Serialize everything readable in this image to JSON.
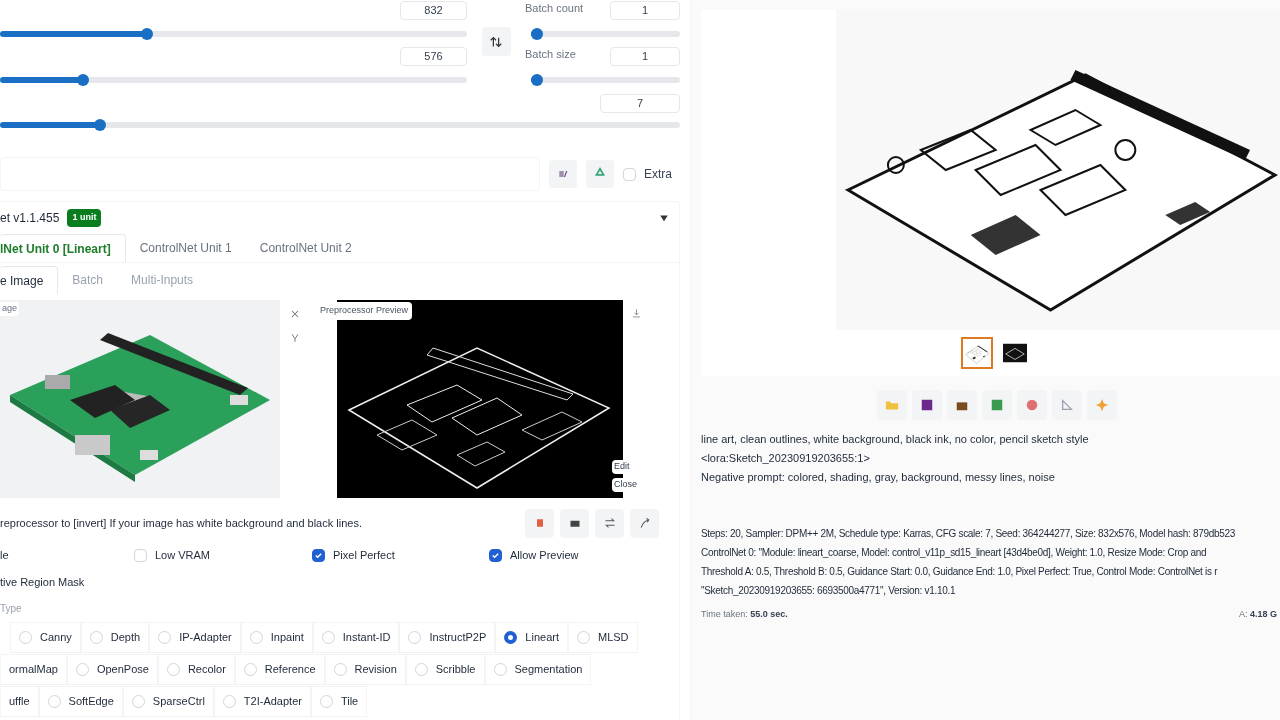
{
  "size_sliders": [
    {
      "value": "832",
      "level": 0.31
    },
    {
      "value": "576",
      "level": 0.17
    }
  ],
  "swap_button": {
    "kind": "swap"
  },
  "batch": [
    {
      "label": "Batch count",
      "value": "1",
      "level": 0
    },
    {
      "label": "Batch size",
      "value": "1",
      "level": 0
    }
  ],
  "cfg_slider": {
    "value": "7",
    "level": 0.14
  },
  "extra": {
    "label": "Extra",
    "checked": false
  },
  "controlnet": {
    "title": "et v1.1.455",
    "badge": "1 unit",
    "expanded": true,
    "unit_tabs": [
      {
        "label": "lNet Unit 0 [Lineart]",
        "selected": true
      },
      {
        "label": "ControlNet Unit 1",
        "selected": false
      },
      {
        "label": "ControlNet Unit 2",
        "selected": false
      }
    ],
    "input_tabs": [
      {
        "label": "e Image",
        "selected": true
      },
      {
        "label": "Batch",
        "selected": false
      },
      {
        "label": "Multi-Inputs",
        "selected": false
      }
    ],
    "image_label": "age",
    "preview_label": "Preprocessor Preview",
    "edit": "Edit",
    "close": "Close",
    "hint": "reprocessor to [invert] If your image has white background and black lines.",
    "options": [
      {
        "label": "le"
      },
      {
        "label": "Low VRAM",
        "checked": false
      },
      {
        "label": "Pixel Perfect",
        "checked": true
      },
      {
        "label": "Allow Preview",
        "checked": true
      }
    ],
    "mask_label": "tive Region Mask",
    "type_label": "Type",
    "control_types": [
      [
        {
          "label": "Canny",
          "selected": false
        },
        {
          "label": "Depth",
          "selected": false
        },
        {
          "label": "IP-Adapter",
          "selected": false
        },
        {
          "label": "Inpaint",
          "selected": false
        },
        {
          "label": "Instant-ID",
          "selected": false
        },
        {
          "label": "InstructP2P",
          "selected": false
        },
        {
          "label": "Lineart",
          "selected": true
        },
        {
          "label": "MLSD",
          "selected": false
        }
      ],
      [
        {
          "label": "ormalMap"
        },
        {
          "label": "OpenPose",
          "selected": false
        },
        {
          "label": "Recolor",
          "selected": false
        },
        {
          "label": "Reference",
          "selected": false
        },
        {
          "label": "Revision",
          "selected": false
        },
        {
          "label": "Scribble",
          "selected": false
        },
        {
          "label": "Segmentation",
          "selected": false
        }
      ],
      [
        {
          "label": "uffle"
        },
        {
          "label": "SoftEdge",
          "selected": false
        },
        {
          "label": "SparseCtrl",
          "selected": false
        },
        {
          "label": "T2I-Adapter",
          "selected": false
        },
        {
          "label": "Tile",
          "selected": false
        }
      ]
    ]
  },
  "output": {
    "thumbnails": [
      {
        "selected": true
      },
      {
        "selected": false
      }
    ],
    "prompt_lines": [
      "line art, clean outlines, white background, black ink, no color, pencil sketch style",
      "<lora:Sketch_20230919203655:1>",
      "Negative prompt: colored, shading, gray, background, messy lines, noise"
    ],
    "param_lines": [
      "Steps: 20, Sampler: DPM++ 2M, Schedule type: Karras, CFG scale: 7, Seed: 364244277, Size: 832x576, Model hash: 879db523",
      "ControlNet 0: \"Module: lineart_coarse, Model: control_v11p_sd15_lineart [43d4be0d], Weight: 1.0, Resize Mode: Crop and",
      "Threshold A: 0.5, Threshold B: 0.5, Guidance Start: 0.0, Guidance End: 1.0, Pixel Perfect: True, Control Mode: ControlNet is r",
      "\"Sketch_20230919203655: 6693500a4771\", Version: v1.10.1"
    ],
    "time_label": "Time taken:",
    "time_value": "55.0 sec.",
    "vram_label": "A:",
    "vram_value": "4.18 G"
  }
}
